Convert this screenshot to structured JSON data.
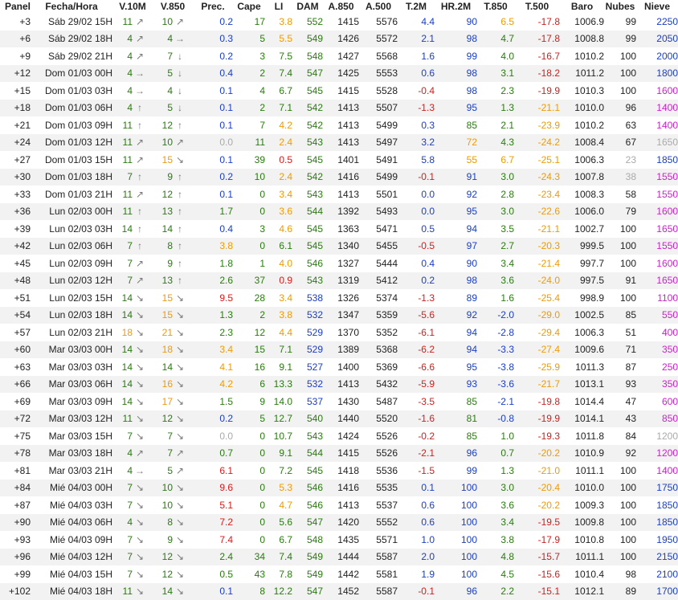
{
  "headers": [
    "Panel",
    "Fecha/Hora",
    "V.10M",
    "V.850",
    "Prec.",
    "Cape",
    "LI",
    "DAM",
    "A.850",
    "A.500",
    "T.2M",
    "HR.2M",
    "T.850",
    "T.500",
    "Baro",
    "Nubes",
    "Nieve"
  ],
  "colors": {
    "green": "#2a7a10",
    "orange": "#f09a00",
    "blue": "#1a3dc8",
    "red": "#d81a1a",
    "magenta": "#d21ad2",
    "gray": "#aaaaaa",
    "arrow": "#7a7a7a"
  },
  "rows": [
    {
      "panel": "+3",
      "fecha": "Sáb 29/02 15H",
      "v10m": "11",
      "v10m_icon": "arrow-ne-icon",
      "v850": "10",
      "v850_icon": "arrow-ne-icon",
      "prec": "0.2",
      "cape": "17",
      "li": "3.8",
      "dam": "552",
      "a850": "1415",
      "a500": "5576",
      "t2m": "4.4",
      "hr2m": "90",
      "t850": "6.5",
      "t500": "-17.8",
      "baro": "1006.9",
      "nubes": "99",
      "nieve": "2250"
    },
    {
      "panel": "+6",
      "fecha": "Sáb 29/02 18H",
      "v10m": "4",
      "v10m_icon": "arrow-ne-icon",
      "v850": "4",
      "v850_icon": "arrow-e-icon",
      "prec": "0.3",
      "cape": "5",
      "li": "5.5",
      "dam": "549",
      "a850": "1426",
      "a500": "5572",
      "t2m": "2.1",
      "hr2m": "98",
      "t850": "4.7",
      "t500": "-17.8",
      "baro": "1008.8",
      "nubes": "99",
      "nieve": "2050"
    },
    {
      "panel": "+9",
      "fecha": "Sáb 29/02 21H",
      "v10m": "4",
      "v10m_icon": "arrow-ne-icon",
      "v850": "7",
      "v850_icon": "arrow-s-icon",
      "prec": "0.2",
      "cape": "3",
      "li": "7.5",
      "dam": "548",
      "a850": "1427",
      "a500": "5568",
      "t2m": "1.6",
      "hr2m": "99",
      "t850": "4.0",
      "t500": "-16.7",
      "baro": "1010.2",
      "nubes": "100",
      "nieve": "2000"
    },
    {
      "panel": "+12",
      "fecha": "Dom 01/03 00H",
      "v10m": "4",
      "v10m_icon": "arrow-e-icon",
      "v850": "5",
      "v850_icon": "arrow-s-icon",
      "prec": "0.4",
      "cape": "2",
      "li": "7.4",
      "dam": "547",
      "a850": "1425",
      "a500": "5553",
      "t2m": "0.6",
      "hr2m": "98",
      "t850": "3.1",
      "t500": "-18.2",
      "baro": "1011.2",
      "nubes": "100",
      "nieve": "1800"
    },
    {
      "panel": "+15",
      "fecha": "Dom 01/03 03H",
      "v10m": "4",
      "v10m_icon": "arrow-e-icon",
      "v850": "4",
      "v850_icon": "arrow-s-icon",
      "prec": "0.1",
      "cape": "4",
      "li": "6.7",
      "dam": "545",
      "a850": "1415",
      "a500": "5528",
      "t2m": "-0.4",
      "hr2m": "98",
      "t850": "2.3",
      "t500": "-19.9",
      "baro": "1010.3",
      "nubes": "100",
      "nieve": "1600"
    },
    {
      "panel": "+18",
      "fecha": "Dom 01/03 06H",
      "v10m": "4",
      "v10m_icon": "arrow-n-icon",
      "v850": "5",
      "v850_icon": "arrow-s-icon",
      "prec": "0.1",
      "cape": "2",
      "li": "7.1",
      "dam": "542",
      "a850": "1413",
      "a500": "5507",
      "t2m": "-1.3",
      "hr2m": "95",
      "t850": "1.3",
      "t500": "-21.1",
      "baro": "1010.0",
      "nubes": "96",
      "nieve": "1400"
    },
    {
      "panel": "+21",
      "fecha": "Dom 01/03 09H",
      "v10m": "11",
      "v10m_icon": "arrow-n-icon",
      "v850": "12",
      "v850_icon": "arrow-n-icon",
      "prec": "0.1",
      "cape": "7",
      "li": "4.2",
      "dam": "542",
      "a850": "1413",
      "a500": "5499",
      "t2m": "0.3",
      "hr2m": "85",
      "t850": "2.1",
      "t500": "-23.9",
      "baro": "1010.2",
      "nubes": "63",
      "nieve": "1400"
    },
    {
      "panel": "+24",
      "fecha": "Dom 01/03 12H",
      "v10m": "11",
      "v10m_icon": "arrow-ne-icon",
      "v850": "10",
      "v850_icon": "arrow-ne-icon",
      "prec": "0.0",
      "cape": "11",
      "li": "2.4",
      "dam": "543",
      "a850": "1413",
      "a500": "5497",
      "t2m": "3.2",
      "hr2m": "72",
      "t850": "4.3",
      "t500": "-24.2",
      "baro": "1008.4",
      "nubes": "67",
      "nieve": "1650"
    },
    {
      "panel": "+27",
      "fecha": "Dom 01/03 15H",
      "v10m": "11",
      "v10m_icon": "arrow-ne-icon",
      "v850": "15",
      "v850_icon": "arrow-se-icon",
      "prec": "0.1",
      "cape": "39",
      "li": "0.5",
      "dam": "545",
      "a850": "1401",
      "a500": "5491",
      "t2m": "5.8",
      "hr2m": "55",
      "t850": "6.7",
      "t500": "-25.1",
      "baro": "1006.3",
      "nubes": "23",
      "nieve": "1850"
    },
    {
      "panel": "+30",
      "fecha": "Dom 01/03 18H",
      "v10m": "7",
      "v10m_icon": "arrow-n-icon",
      "v850": "9",
      "v850_icon": "arrow-n-icon",
      "prec": "0.2",
      "cape": "10",
      "li": "2.4",
      "dam": "542",
      "a850": "1416",
      "a500": "5499",
      "t2m": "-0.1",
      "hr2m": "91",
      "t850": "3.0",
      "t500": "-24.3",
      "baro": "1007.8",
      "nubes": "38",
      "nieve": "1550"
    },
    {
      "panel": "+33",
      "fecha": "Dom 01/03 21H",
      "v10m": "11",
      "v10m_icon": "arrow-ne-icon",
      "v850": "12",
      "v850_icon": "arrow-n-icon",
      "prec": "0.1",
      "cape": "0",
      "li": "3.4",
      "dam": "543",
      "a850": "1413",
      "a500": "5501",
      "t2m": "0.0",
      "hr2m": "92",
      "t850": "2.8",
      "t500": "-23.4",
      "baro": "1008.3",
      "nubes": "58",
      "nieve": "1550"
    },
    {
      "panel": "+36",
      "fecha": "Lun 02/03 00H",
      "v10m": "11",
      "v10m_icon": "arrow-n-icon",
      "v850": "13",
      "v850_icon": "arrow-n-icon",
      "prec": "1.7",
      "cape": "0",
      "li": "3.6",
      "dam": "544",
      "a850": "1392",
      "a500": "5493",
      "t2m": "0.0",
      "hr2m": "95",
      "t850": "3.0",
      "t500": "-22.6",
      "baro": "1006.0",
      "nubes": "79",
      "nieve": "1600"
    },
    {
      "panel": "+39",
      "fecha": "Lun 02/03 03H",
      "v10m": "14",
      "v10m_icon": "arrow-n-icon",
      "v850": "14",
      "v850_icon": "arrow-n-icon",
      "prec": "0.4",
      "cape": "3",
      "li": "4.6",
      "dam": "545",
      "a850": "1363",
      "a500": "5471",
      "t2m": "0.5",
      "hr2m": "94",
      "t850": "3.5",
      "t500": "-21.1",
      "baro": "1002.7",
      "nubes": "100",
      "nieve": "1650"
    },
    {
      "panel": "+42",
      "fecha": "Lun 02/03 06H",
      "v10m": "7",
      "v10m_icon": "arrow-n-icon",
      "v850": "8",
      "v850_icon": "arrow-n-icon",
      "prec": "3.8",
      "cape": "0",
      "li": "6.1",
      "dam": "545",
      "a850": "1340",
      "a500": "5455",
      "t2m": "-0.5",
      "hr2m": "97",
      "t850": "2.7",
      "t500": "-20.3",
      "baro": "999.5",
      "nubes": "100",
      "nieve": "1550"
    },
    {
      "panel": "+45",
      "fecha": "Lun 02/03 09H",
      "v10m": "7",
      "v10m_icon": "arrow-ne-icon",
      "v850": "9",
      "v850_icon": "arrow-n-icon",
      "prec": "1.8",
      "cape": "1",
      "li": "4.0",
      "dam": "546",
      "a850": "1327",
      "a500": "5444",
      "t2m": "0.4",
      "hr2m": "90",
      "t850": "3.4",
      "t500": "-21.4",
      "baro": "997.7",
      "nubes": "100",
      "nieve": "1600"
    },
    {
      "panel": "+48",
      "fecha": "Lun 02/03 12H",
      "v10m": "7",
      "v10m_icon": "arrow-ne-icon",
      "v850": "13",
      "v850_icon": "arrow-n-icon",
      "prec": "2.6",
      "cape": "37",
      "li": "0.9",
      "dam": "543",
      "a850": "1319",
      "a500": "5412",
      "t2m": "0.2",
      "hr2m": "98",
      "t850": "3.6",
      "t500": "-24.0",
      "baro": "997.5",
      "nubes": "91",
      "nieve": "1650"
    },
    {
      "panel": "+51",
      "fecha": "Lun 02/03 15H",
      "v10m": "14",
      "v10m_icon": "arrow-se-icon",
      "v850": "15",
      "v850_icon": "arrow-se-icon",
      "prec": "9.5",
      "cape": "28",
      "li": "3.4",
      "dam": "538",
      "a850": "1326",
      "a500": "5374",
      "t2m": "-1.3",
      "hr2m": "89",
      "t850": "1.6",
      "t500": "-25.4",
      "baro": "998.9",
      "nubes": "100",
      "nieve": "1100"
    },
    {
      "panel": "+54",
      "fecha": "Lun 02/03 18H",
      "v10m": "14",
      "v10m_icon": "arrow-se-icon",
      "v850": "15",
      "v850_icon": "arrow-se-icon",
      "prec": "1.3",
      "cape": "2",
      "li": "3.8",
      "dam": "532",
      "a850": "1347",
      "a500": "5359",
      "t2m": "-5.6",
      "hr2m": "92",
      "t850": "-2.0",
      "t500": "-29.0",
      "baro": "1002.5",
      "nubes": "85",
      "nieve": "550"
    },
    {
      "panel": "+57",
      "fecha": "Lun 02/03 21H",
      "v10m": "18",
      "v10m_icon": "arrow-se-icon",
      "v850": "21",
      "v850_icon": "arrow-se-icon",
      "prec": "2.3",
      "cape": "12",
      "li": "4.4",
      "dam": "529",
      "a850": "1370",
      "a500": "5352",
      "t2m": "-6.1",
      "hr2m": "94",
      "t850": "-2.8",
      "t500": "-29.4",
      "baro": "1006.3",
      "nubes": "51",
      "nieve": "400"
    },
    {
      "panel": "+60",
      "fecha": "Mar 03/03 00H",
      "v10m": "14",
      "v10m_icon": "arrow-se-icon",
      "v850": "18",
      "v850_icon": "arrow-se-icon",
      "prec": "3.4",
      "cape": "15",
      "li": "7.1",
      "dam": "529",
      "a850": "1389",
      "a500": "5368",
      "t2m": "-6.2",
      "hr2m": "94",
      "t850": "-3.3",
      "t500": "-27.4",
      "baro": "1009.6",
      "nubes": "71",
      "nieve": "350"
    },
    {
      "panel": "+63",
      "fecha": "Mar 03/03 03H",
      "v10m": "14",
      "v10m_icon": "arrow-se-icon",
      "v850": "14",
      "v850_icon": "arrow-se-icon",
      "prec": "4.1",
      "cape": "16",
      "li": "9.1",
      "dam": "527",
      "a850": "1400",
      "a500": "5369",
      "t2m": "-6.6",
      "hr2m": "95",
      "t850": "-3.8",
      "t500": "-25.9",
      "baro": "1011.3",
      "nubes": "87",
      "nieve": "250"
    },
    {
      "panel": "+66",
      "fecha": "Mar 03/03 06H",
      "v10m": "14",
      "v10m_icon": "arrow-se-icon",
      "v850": "16",
      "v850_icon": "arrow-se-icon",
      "prec": "4.2",
      "cape": "6",
      "li": "13.3",
      "dam": "532",
      "a850": "1413",
      "a500": "5432",
      "t2m": "-5.9",
      "hr2m": "93",
      "t850": "-3.6",
      "t500": "-21.7",
      "baro": "1013.1",
      "nubes": "93",
      "nieve": "350"
    },
    {
      "panel": "+69",
      "fecha": "Mar 03/03 09H",
      "v10m": "14",
      "v10m_icon": "arrow-se-icon",
      "v850": "17",
      "v850_icon": "arrow-se-icon",
      "prec": "1.5",
      "cape": "9",
      "li": "14.0",
      "dam": "537",
      "a850": "1430",
      "a500": "5487",
      "t2m": "-3.5",
      "hr2m": "85",
      "t850": "-2.1",
      "t500": "-19.8",
      "baro": "1014.4",
      "nubes": "47",
      "nieve": "600"
    },
    {
      "panel": "+72",
      "fecha": "Mar 03/03 12H",
      "v10m": "11",
      "v10m_icon": "arrow-se-icon",
      "v850": "12",
      "v850_icon": "arrow-se-icon",
      "prec": "0.2",
      "cape": "5",
      "li": "12.7",
      "dam": "540",
      "a850": "1440",
      "a500": "5520",
      "t2m": "-1.6",
      "hr2m": "81",
      "t850": "-0.8",
      "t500": "-19.9",
      "baro": "1014.1",
      "nubes": "43",
      "nieve": "850"
    },
    {
      "panel": "+75",
      "fecha": "Mar 03/03 15H",
      "v10m": "7",
      "v10m_icon": "arrow-se-icon",
      "v850": "7",
      "v850_icon": "arrow-se-icon",
      "prec": "0.0",
      "cape": "0",
      "li": "10.7",
      "dam": "543",
      "a850": "1424",
      "a500": "5526",
      "t2m": "-0.2",
      "hr2m": "85",
      "t850": "1.0",
      "t500": "-19.3",
      "baro": "1011.8",
      "nubes": "84",
      "nieve": "1200"
    },
    {
      "panel": "+78",
      "fecha": "Mar 03/03 18H",
      "v10m": "4",
      "v10m_icon": "arrow-ne-icon",
      "v850": "7",
      "v850_icon": "arrow-ne-icon",
      "prec": "0.7",
      "cape": "0",
      "li": "9.1",
      "dam": "544",
      "a850": "1415",
      "a500": "5526",
      "t2m": "-2.1",
      "hr2m": "96",
      "t850": "0.7",
      "t500": "-20.2",
      "baro": "1010.9",
      "nubes": "92",
      "nieve": "1200"
    },
    {
      "panel": "+81",
      "fecha": "Mar 03/03 21H",
      "v10m": "4",
      "v10m_icon": "arrow-e-icon",
      "v850": "5",
      "v850_icon": "arrow-ne-icon",
      "prec": "6.1",
      "cape": "0",
      "li": "7.2",
      "dam": "545",
      "a850": "1418",
      "a500": "5536",
      "t2m": "-1.5",
      "hr2m": "99",
      "t850": "1.3",
      "t500": "-21.0",
      "baro": "1011.1",
      "nubes": "100",
      "nieve": "1400"
    },
    {
      "panel": "+84",
      "fecha": "Mié 04/03 00H",
      "v10m": "7",
      "v10m_icon": "arrow-se-icon",
      "v850": "10",
      "v850_icon": "arrow-se-icon",
      "prec": "9.6",
      "cape": "0",
      "li": "5.3",
      "dam": "546",
      "a850": "1416",
      "a500": "5535",
      "t2m": "0.1",
      "hr2m": "100",
      "t850": "3.0",
      "t500": "-20.4",
      "baro": "1010.0",
      "nubes": "100",
      "nieve": "1750"
    },
    {
      "panel": "+87",
      "fecha": "Mié 04/03 03H",
      "v10m": "7",
      "v10m_icon": "arrow-se-icon",
      "v850": "10",
      "v850_icon": "arrow-se-icon",
      "prec": "5.1",
      "cape": "0",
      "li": "4.7",
      "dam": "546",
      "a850": "1413",
      "a500": "5537",
      "t2m": "0.6",
      "hr2m": "100",
      "t850": "3.6",
      "t500": "-20.2",
      "baro": "1009.3",
      "nubes": "100",
      "nieve": "1850"
    },
    {
      "panel": "+90",
      "fecha": "Mié 04/03 06H",
      "v10m": "4",
      "v10m_icon": "arrow-se-icon",
      "v850": "8",
      "v850_icon": "arrow-se-icon",
      "prec": "7.2",
      "cape": "0",
      "li": "5.6",
      "dam": "547",
      "a850": "1420",
      "a500": "5552",
      "t2m": "0.6",
      "hr2m": "100",
      "t850": "3.4",
      "t500": "-19.5",
      "baro": "1009.8",
      "nubes": "100",
      "nieve": "1850"
    },
    {
      "panel": "+93",
      "fecha": "Mié 04/03 09H",
      "v10m": "7",
      "v10m_icon": "arrow-se-icon",
      "v850": "9",
      "v850_icon": "arrow-se-icon",
      "prec": "7.4",
      "cape": "0",
      "li": "6.7",
      "dam": "548",
      "a850": "1435",
      "a500": "5571",
      "t2m": "1.0",
      "hr2m": "100",
      "t850": "3.8",
      "t500": "-17.9",
      "baro": "1010.8",
      "nubes": "100",
      "nieve": "1950"
    },
    {
      "panel": "+96",
      "fecha": "Mié 04/03 12H",
      "v10m": "7",
      "v10m_icon": "arrow-se-icon",
      "v850": "12",
      "v850_icon": "arrow-se-icon",
      "prec": "2.4",
      "cape": "34",
      "li": "7.4",
      "dam": "549",
      "a850": "1444",
      "a500": "5587",
      "t2m": "2.0",
      "hr2m": "100",
      "t850": "4.8",
      "t500": "-15.7",
      "baro": "1011.1",
      "nubes": "100",
      "nieve": "2150"
    },
    {
      "panel": "+99",
      "fecha": "Mié 04/03 15H",
      "v10m": "7",
      "v10m_icon": "arrow-se-icon",
      "v850": "12",
      "v850_icon": "arrow-se-icon",
      "prec": "0.5",
      "cape": "43",
      "li": "7.8",
      "dam": "549",
      "a850": "1442",
      "a500": "5581",
      "t2m": "1.9",
      "hr2m": "100",
      "t850": "4.5",
      "t500": "-15.6",
      "baro": "1010.4",
      "nubes": "98",
      "nieve": "2100"
    },
    {
      "panel": "+102",
      "fecha": "Mié 04/03 18H",
      "v10m": "11",
      "v10m_icon": "arrow-se-icon",
      "v850": "14",
      "v850_icon": "arrow-se-icon",
      "prec": "0.1",
      "cape": "8",
      "li": "12.2",
      "dam": "547",
      "a850": "1452",
      "a500": "5587",
      "t2m": "-0.1",
      "hr2m": "96",
      "t850": "2.2",
      "t500": "-15.1",
      "baro": "1012.1",
      "nubes": "89",
      "nieve": "1700"
    }
  ]
}
